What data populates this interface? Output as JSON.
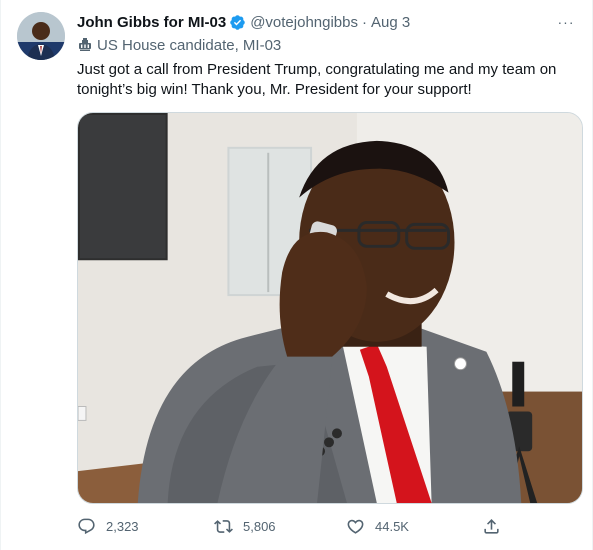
{
  "tweet": {
    "author_name": "John Gibbs for MI-03",
    "handle": "@votejohngibbs",
    "separator": "·",
    "date": "Aug 3",
    "more_label": "···",
    "account_label": "US House candidate, MI-03",
    "text": "Just got a call from President Trump, congratulating me and my team on tonight’s big win! Thank you, Mr. President for your support!"
  },
  "actions": {
    "replies": "2,323",
    "retweets": "5,806",
    "likes": "44.5K"
  },
  "icons": {
    "verified": "verified-badge-icon",
    "label": "government-building-icon",
    "reply": "reply-icon",
    "retweet": "retweet-icon",
    "like": "heart-icon",
    "share": "share-icon"
  },
  "colors": {
    "verified_blue": "#1d9bf0",
    "secondary_text": "#536471",
    "primary_text": "#0f1419",
    "tie_red": "#d4141c"
  }
}
